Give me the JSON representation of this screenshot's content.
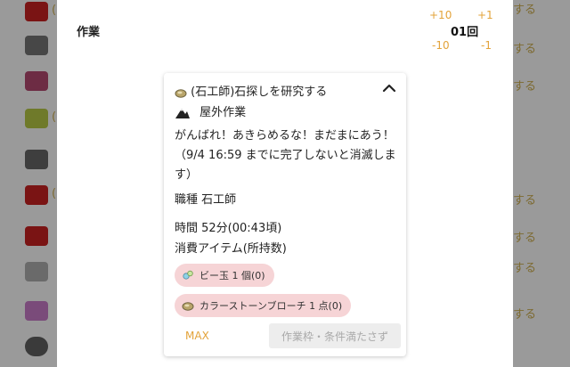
{
  "background": {
    "right_labels": [
      "する",
      "する",
      "する",
      "する",
      "する",
      "する",
      "する"
    ],
    "left_snippets": [
      "(",
      "(",
      "("
    ]
  },
  "modal": {
    "title": "作業",
    "step_buttons": {
      "plus10": "+10",
      "plus1": "+1",
      "minus10": "-10",
      "minus1": "-1"
    },
    "count": "01回"
  },
  "card": {
    "heading": "(石工師)石探しを研究する",
    "tag": "屋外作業",
    "message": "がんばれ！あきらめるな！まだまにあう！（9/4 16:59 までに完了しないと消滅します）",
    "job": "職種 石工師",
    "time": "時間 52分(00:43頃)",
    "consume_label": "消費アイテム(所持数)",
    "items": [
      "ビー玉 1 個(0)",
      "カラーストーンブローチ 1 点(0)"
    ],
    "max_label": "MAX",
    "submit_label": "作業枠・条件満たさず"
  },
  "colors": {
    "accent": "#e3a33a",
    "chip_bg": "#f6d4d6",
    "overlay": "#9a9a9a"
  },
  "icons": {
    "heading": "stone-icon",
    "tag": "mountain-icon",
    "chip1": "marble-icon",
    "chip2": "brooch-icon",
    "collapse": "chevron-up-icon"
  }
}
